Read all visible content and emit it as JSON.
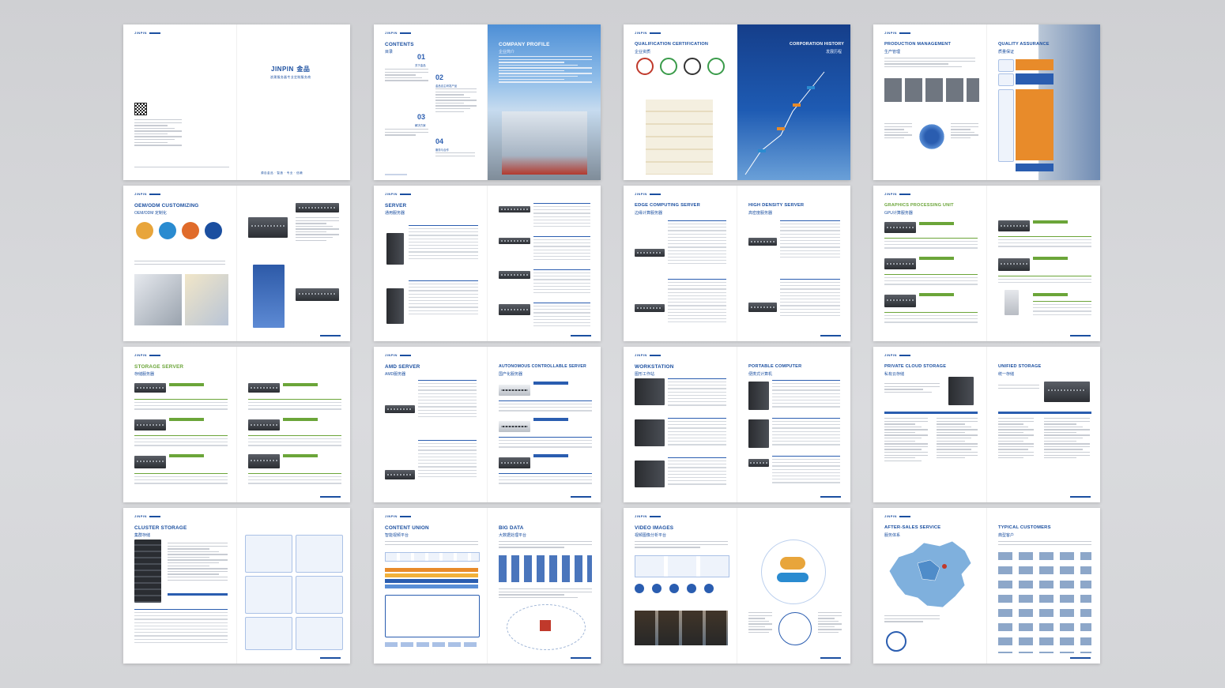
{
  "brochure": {
    "brand": "JINPIN",
    "brand_cn": "金品",
    "cover_subtitle": "浪潮服务器专业定制服务商",
    "cover_slogan": "源自金品 · 智造 · 专业 · 信赖"
  },
  "spreads": [
    {
      "left_title": "",
      "left_cn": "",
      "right_title": "",
      "right_cn": ""
    },
    {
      "left_title": "CONTENTS",
      "left_cn": "目录",
      "right_title": "COMPANY PROFILE",
      "right_cn": "企业简介",
      "toc": [
        {
          "num": "01",
          "label": "关于金品"
        },
        {
          "num": "02",
          "label": "金品自主研发产品"
        },
        {
          "num": "03",
          "label": "解决方案"
        },
        {
          "num": "04",
          "label": "服务与合作"
        }
      ]
    },
    {
      "left_title": "QUALIFICATION CERTIFICATION",
      "left_cn": "企业资质",
      "right_title": "CORPORATION HISTORY",
      "right_cn": "发展历程"
    },
    {
      "left_title": "PRODUCTION MANAGEMENT",
      "left_cn": "生产管理",
      "right_title": "QUALITY ASSURANCE",
      "right_cn": "质量保证"
    },
    {
      "left_title": "OEM/ODM CUSTOMIZING",
      "left_cn": "OEM/ODM 定制化",
      "right_title": "",
      "right_cn": ""
    },
    {
      "left_title": "SERVER",
      "left_cn": "通用服务器",
      "right_title": "",
      "right_cn": ""
    },
    {
      "left_title": "EDGE COMPUTING SERVER",
      "left_cn": "边缘计算服务器",
      "right_title": "HIGH DENSITY SERVER",
      "right_cn": "高密度服务器"
    },
    {
      "left_title": "GRAPHICS PROCESSING UNIT",
      "left_cn": "GPU计算服务器",
      "right_title": "",
      "right_cn": ""
    },
    {
      "left_title": "STORAGE SERVER",
      "left_cn": "存储服务器",
      "right_title": "",
      "right_cn": ""
    },
    {
      "left_title": "AMD SERVER",
      "left_cn": "AMD服务器",
      "right_title": "AUTONOMOUS CONTROLLABLE SERVER",
      "right_cn": "国产化服务器"
    },
    {
      "left_title": "WORKSTATION",
      "left_cn": "图形工作站",
      "right_title": "PORTABLE COMPUTER",
      "right_cn": "便携式计算机"
    },
    {
      "left_title": "PRIVATE CLOUD STORAGE",
      "left_cn": "私有云存储",
      "right_title": "UNIFIED STORAGE",
      "right_cn": "统一存储"
    },
    {
      "left_title": "CLUSTER STORAGE",
      "left_cn": "集群存储",
      "right_title": "",
      "right_cn": ""
    },
    {
      "left_title": "CONTENT UNION",
      "left_cn": "智能视频平台",
      "right_title": "BIG DATA",
      "right_cn": "大数据处理平台"
    },
    {
      "left_title": "VIDEO IMAGES",
      "left_cn": "视频图像分析平台",
      "right_title": "",
      "right_cn": ""
    },
    {
      "left_title": "AFTER-SALES SERVICE",
      "left_cn": "服务体系",
      "right_title": "TYPICAL CUSTOMERS",
      "right_cn": "典型客户"
    }
  ],
  "colors": {
    "primary": "#1b4fa0",
    "accent_green": "#6ba539",
    "accent_orange": "#e88b2a",
    "background": "#d4d5d8"
  }
}
